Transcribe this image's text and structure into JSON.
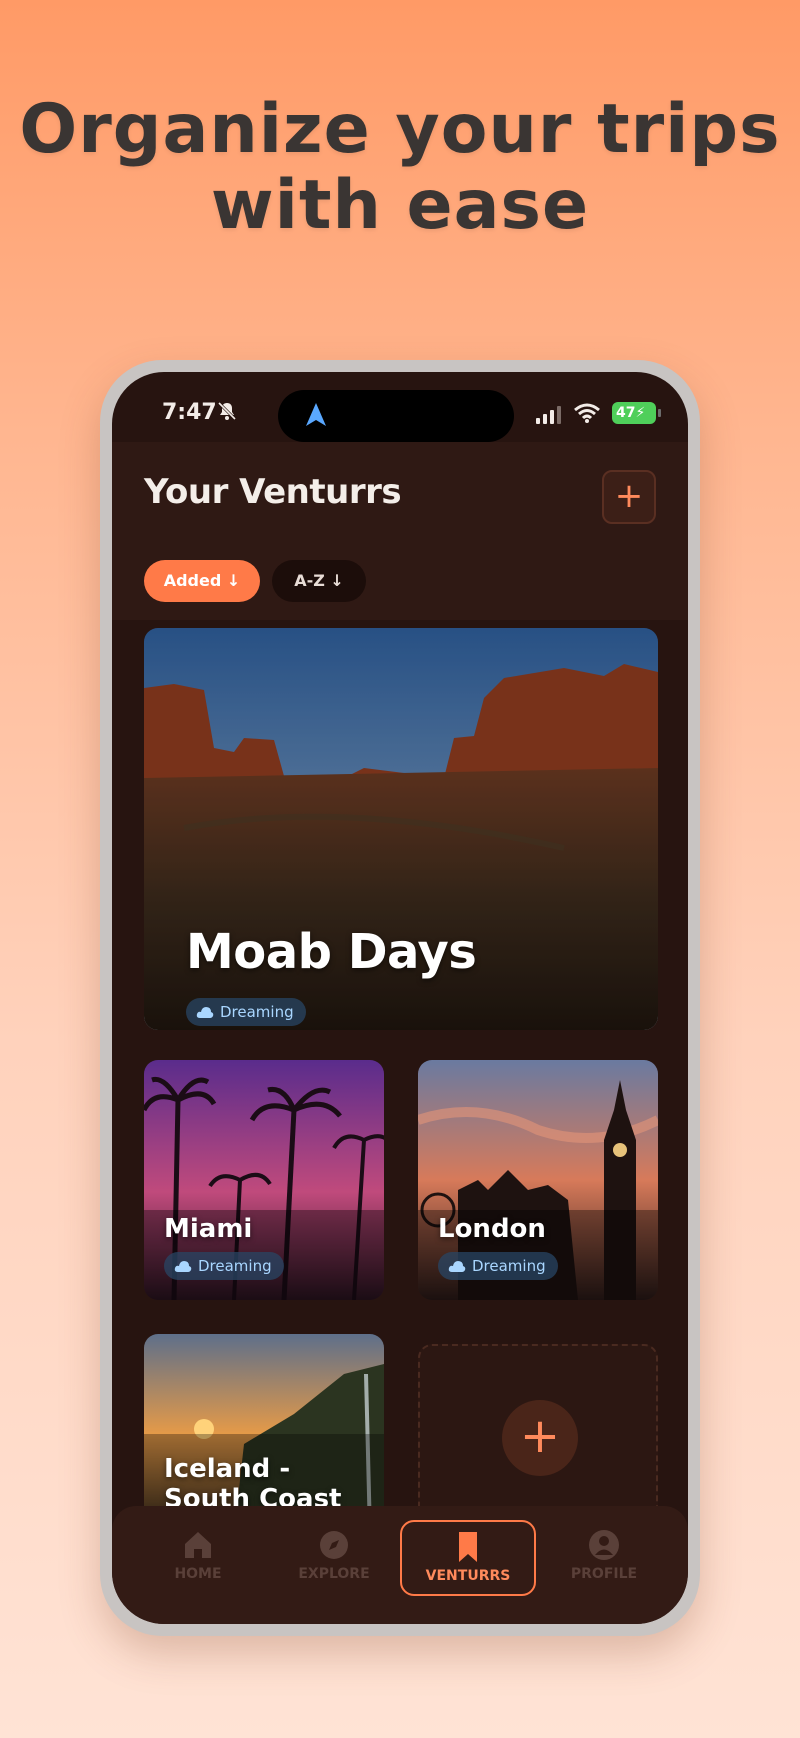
{
  "headline": {
    "line1": "Organize your trips",
    "line2": "with ease"
  },
  "status_bar": {
    "time": "7:47",
    "battery": "47"
  },
  "header": {
    "title": "Your Venturrs",
    "add_button_label": "+",
    "sort_chips": [
      {
        "label": "Added ↓",
        "active": true
      },
      {
        "label": "A-Z ↓",
        "active": false
      }
    ]
  },
  "trips": [
    {
      "name": "Moab Days",
      "status": "Dreaming"
    },
    {
      "name": "Miami",
      "status": "Dreaming"
    },
    {
      "name": "London",
      "status": "Dreaming"
    },
    {
      "name": "Iceland - South Coast",
      "status": ""
    }
  ],
  "new_trip_button_label": "+",
  "tabbar": {
    "items": [
      {
        "label": "HOME",
        "icon": "home-icon",
        "active": false
      },
      {
        "label": "EXPLORE",
        "icon": "compass-icon",
        "active": false
      },
      {
        "label": "VENTURRS",
        "icon": "bookmark-icon",
        "active": true
      },
      {
        "label": "PROFILE",
        "icon": "user-icon",
        "active": false
      }
    ]
  },
  "colors": {
    "accent": "#ff7a48",
    "background_top": "#ff9a66",
    "screen_bg": "#271410",
    "badge_text": "#a9d6ff"
  }
}
